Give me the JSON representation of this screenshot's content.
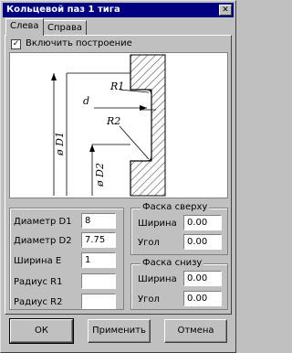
{
  "window": {
    "title": "Кольцевой паз 1 тига",
    "close_glyph": "✕"
  },
  "tabs": [
    {
      "label": "Слева",
      "active": true
    },
    {
      "label": "Справа",
      "active": false
    }
  ],
  "enable_build": {
    "label": "Включить построение",
    "checked": true
  },
  "drawing": {
    "labels": {
      "r1": "R1",
      "d": "d",
      "r2": "R2",
      "d1": "ø D1",
      "d2": "ø D2"
    }
  },
  "params": {
    "d1": {
      "label": "Диаметр D1",
      "value": "8"
    },
    "d2": {
      "label": "Диаметр D2",
      "value": "7.75"
    },
    "width": {
      "label": "Ширина E",
      "value": "1"
    },
    "r1": {
      "label": "Радиус R1",
      "value": ""
    },
    "r2": {
      "label": "Радиус R2",
      "value": ""
    }
  },
  "chamfer_top": {
    "title": "Фаска сверху",
    "width": {
      "label": "Ширина",
      "value": "0.00"
    },
    "angle": {
      "label": "Угол",
      "value": "0.00"
    }
  },
  "chamfer_bottom": {
    "title": "Фаска снизу",
    "width": {
      "label": "Ширина",
      "value": "0.00"
    },
    "angle": {
      "label": "Угол",
      "value": "0.00"
    }
  },
  "buttons": {
    "ok": "ОК",
    "apply": "Применить",
    "cancel": "Отмена"
  }
}
